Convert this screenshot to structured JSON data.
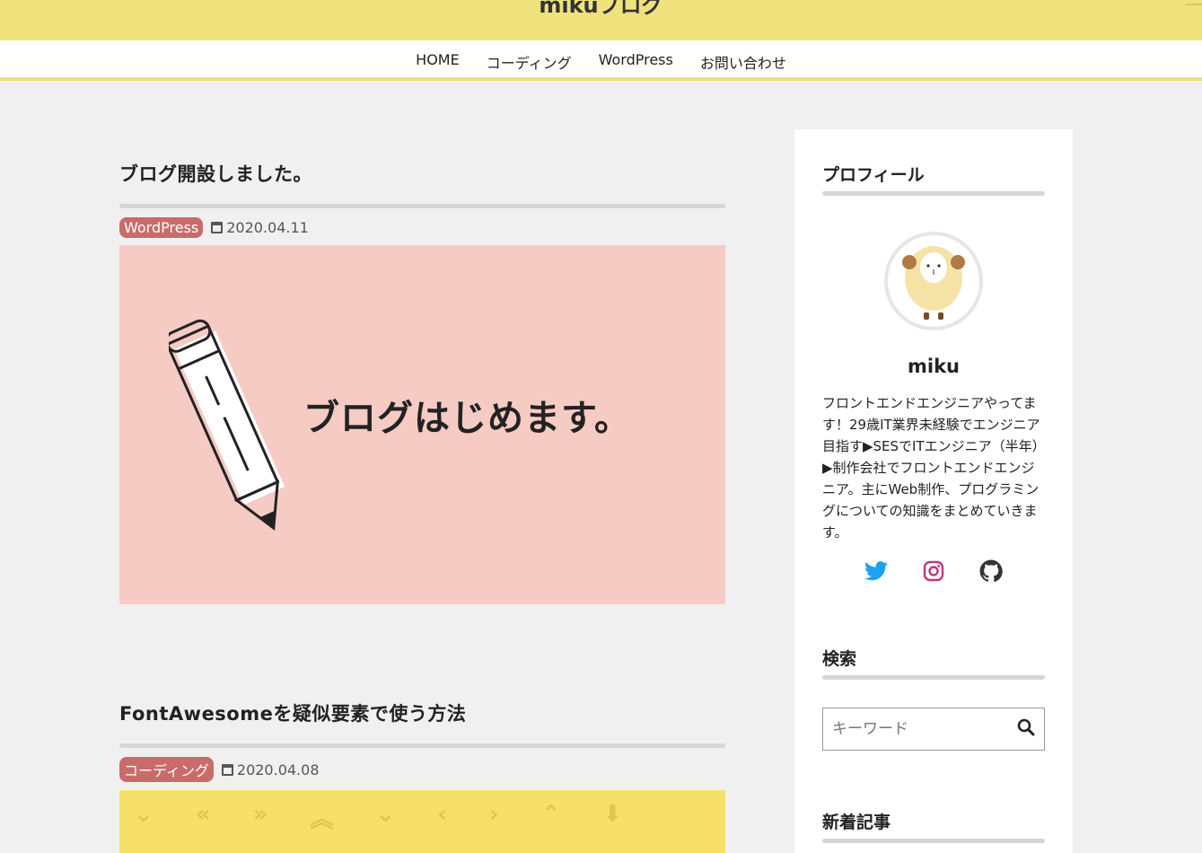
{
  "site": {
    "title": "mikuブログ"
  },
  "nav": {
    "items": [
      "HOME",
      "コーディング",
      "WordPress",
      "お問い合わせ"
    ]
  },
  "posts": [
    {
      "title": "ブログ開設しました。",
      "category": "WordPress",
      "date": "2020.04.11",
      "thumbnail_text": "ブログはじめます。",
      "thumbnail_color": "#f5cbc4"
    },
    {
      "title": "FontAwesomeを疑似要素で使う方法",
      "category": "コーディング",
      "date": "2020.04.08",
      "thumbnail_color": "#f7e06a"
    }
  ],
  "sidebar": {
    "profile": {
      "title": "プロフィール",
      "name": "miku",
      "bio": "フロントエンドエンジニアやってます！29歳IT業界未経験でエンジニア目指す▶SESでITエンジニア（半年）▶制作会社でフロントエンドエンジニア。主にWeb制作、プログラミングについての知識をまとめていきます。",
      "social": [
        "twitter-icon",
        "instagram-icon",
        "github-icon"
      ]
    },
    "search": {
      "title": "検索",
      "placeholder": "キーワード"
    },
    "recent": {
      "title": "新着記事"
    }
  },
  "colors": {
    "header": "#efe27c",
    "category_badge": "#c96b6b",
    "twitter": "#1da1f2",
    "instagram": "#c13584",
    "github": "#333333"
  }
}
